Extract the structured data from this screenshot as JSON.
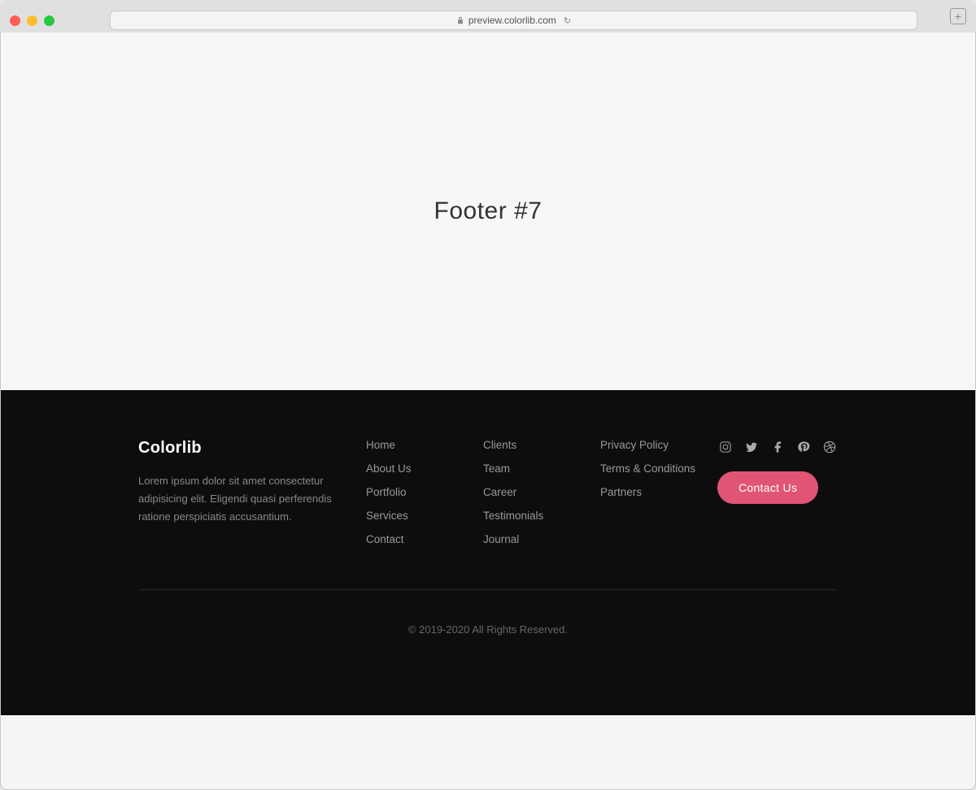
{
  "browser": {
    "url": "preview.colorlib.com",
    "new_tab_label": "+"
  },
  "main": {
    "page_heading": "Footer #7"
  },
  "footer": {
    "brand": {
      "name": "Colorlib",
      "description": "Lorem ipsum dolor sit amet consectetur adipisicing elit. Eligendi quasi perferendis ratione perspiciatis accusantium."
    },
    "col1_links": [
      {
        "label": "Home"
      },
      {
        "label": "About Us"
      },
      {
        "label": "Portfolio"
      },
      {
        "label": "Services"
      },
      {
        "label": "Contact"
      }
    ],
    "col2_links": [
      {
        "label": "Clients"
      },
      {
        "label": "Team"
      },
      {
        "label": "Career"
      },
      {
        "label": "Testimonials"
      },
      {
        "label": "Journal"
      }
    ],
    "col3_links": [
      {
        "label": "Privacy Policy"
      },
      {
        "label": "Terms & Conditions"
      },
      {
        "label": "Partners"
      }
    ],
    "social": {
      "contact_button_label": "Contact Us"
    },
    "copyright": "© 2019-2020 All Rights Reserved."
  }
}
